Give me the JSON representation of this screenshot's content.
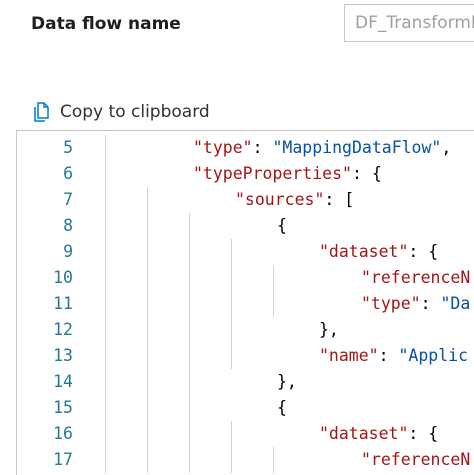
{
  "header": {
    "field_label": "Data flow name",
    "field_value": "DF_TransformP"
  },
  "toolbar": {
    "copy_label": "Copy to clipboard",
    "copy_icon": "copy-icon"
  },
  "editor": {
    "lines": [
      {
        "n": "5",
        "indent": 2,
        "parts": [
          {
            "t": "\"type\"",
            "c": "k"
          },
          {
            "t": ": ",
            "c": "p"
          },
          {
            "t": "\"MappingDataFlow\"",
            "c": "s"
          },
          {
            "t": ",",
            "c": "p"
          }
        ]
      },
      {
        "n": "6",
        "indent": 2,
        "parts": [
          {
            "t": "\"typeProperties\"",
            "c": "k"
          },
          {
            "t": ": {",
            "c": "p"
          }
        ]
      },
      {
        "n": "7",
        "indent": 3,
        "parts": [
          {
            "t": "\"sources\"",
            "c": "k"
          },
          {
            "t": ": [",
            "c": "p"
          }
        ]
      },
      {
        "n": "8",
        "indent": 4,
        "parts": [
          {
            "t": "{",
            "c": "p"
          }
        ]
      },
      {
        "n": "9",
        "indent": 5,
        "parts": [
          {
            "t": "\"dataset\"",
            "c": "k"
          },
          {
            "t": ": {",
            "c": "p"
          }
        ]
      },
      {
        "n": "10",
        "indent": 6,
        "parts": [
          {
            "t": "\"referenceN",
            "c": "k"
          }
        ]
      },
      {
        "n": "11",
        "indent": 6,
        "parts": [
          {
            "t": "\"type\"",
            "c": "k"
          },
          {
            "t": ": ",
            "c": "p"
          },
          {
            "t": "\"Da",
            "c": "s"
          }
        ]
      },
      {
        "n": "12",
        "indent": 5,
        "parts": [
          {
            "t": "},",
            "c": "p"
          }
        ]
      },
      {
        "n": "13",
        "indent": 5,
        "parts": [
          {
            "t": "\"name\"",
            "c": "k"
          },
          {
            "t": ": ",
            "c": "p"
          },
          {
            "t": "\"Applic",
            "c": "s"
          }
        ]
      },
      {
        "n": "14",
        "indent": 4,
        "parts": [
          {
            "t": "},",
            "c": "p"
          }
        ]
      },
      {
        "n": "15",
        "indent": 4,
        "parts": [
          {
            "t": "{",
            "c": "p"
          }
        ]
      },
      {
        "n": "16",
        "indent": 5,
        "parts": [
          {
            "t": "\"dataset\"",
            "c": "k"
          },
          {
            "t": ": {",
            "c": "p"
          }
        ]
      },
      {
        "n": "17",
        "indent": 6,
        "parts": [
          {
            "t": "\"referenceN",
            "c": "k"
          }
        ]
      }
    ]
  }
}
